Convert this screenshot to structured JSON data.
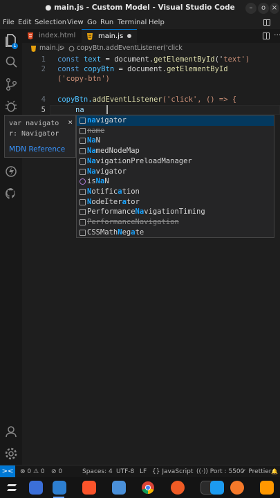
{
  "window": {
    "title": "● main.js - Custom Model - Visual Studio Code",
    "minimize": "–",
    "restore": "o",
    "close": "×"
  },
  "menu": [
    "File",
    "Edit",
    "Selection",
    "View",
    "Go",
    "Run",
    "Terminal",
    "Help"
  ],
  "tabs": [
    {
      "label": "index.html",
      "icon": "html-file-icon",
      "active": false
    },
    {
      "label": "main.js",
      "icon": "js-file-icon",
      "active": true,
      "modified": true
    }
  ],
  "breadcrumb": {
    "file": "main.js",
    "sep": "›",
    "symbol": "copyBtn.addEventListener('click"
  },
  "editor": {
    "line_numbers": [
      "1",
      "2",
      "3",
      "4",
      "5"
    ],
    "lines": [
      {
        "t1": "const ",
        "t2": "text",
        "t3": " = document.",
        "t4": "getElementById",
        "t5": "('",
        "t6": "text",
        "t7": "')"
      },
      {
        "t1": "const ",
        "t2": "copyBtn",
        "t3": " = document.",
        "t4": "getElementById"
      },
      {
        "t1": "('copy-btn')"
      },
      {
        "t1": "copyBtn.",
        "t2": "addEventListener",
        "t3": "('click', () => {"
      },
      {
        "t1": "na"
      }
    ]
  },
  "hover_doc": {
    "signature": "var navigator: Navigator",
    "close": "×",
    "link": "MDN Reference"
  },
  "suggestions": [
    {
      "label": "navigator",
      "match": "na",
      "rest": "vigator",
      "icon": "variable-icon",
      "selected": true
    },
    {
      "label": "name",
      "icon": "variable-icon",
      "deprecated": true
    },
    {
      "label": "NaN",
      "match": "Na",
      "rest": "N",
      "icon": "variable-icon"
    },
    {
      "label": "NamedNodeMap",
      "match": "Na",
      "rest": "medNodeMap",
      "icon": "variable-icon"
    },
    {
      "label": "NavigationPreloadManager",
      "match": "Na",
      "rest": "vigationPreloadManager",
      "icon": "variable-icon"
    },
    {
      "label": "Navigator",
      "match": "Na",
      "rest": "vigator",
      "icon": "variable-icon"
    },
    {
      "label": "isNaN",
      "pre": "is",
      "match": "Na",
      "rest": "N",
      "icon": "function-icon"
    },
    {
      "label": "Notification",
      "html": "<b>N</b>otific<b>a</b>tion",
      "icon": "variable-icon"
    },
    {
      "label": "NodeIterator",
      "html": "<b>N</b>odeIter<b>a</b>tor",
      "icon": "variable-icon"
    },
    {
      "label": "PerformanceNavigationTiming",
      "html": "Performance<b>Na</b>vigationTiming",
      "icon": "variable-icon"
    },
    {
      "label": "PerformanceNavigation",
      "icon": "variable-icon",
      "deprecated": true
    },
    {
      "label": "CSSMathNegate",
      "html": "CSSMath<b>N</b>eg<b>a</b>te",
      "icon": "variable-icon"
    }
  ],
  "status": {
    "remote": "><",
    "problems": "⊗ 0 ⚠ 0",
    "ports": "⊘ 0",
    "spaces": "Spaces: 4",
    "encoding": "UTF-8",
    "eol": "LF",
    "language": "{} JavaScript",
    "port": "((·)) Port : 5500",
    "prettier": "✓ Prettier",
    "bell": "🔔"
  },
  "taskbar": [
    "zorin-menu-icon",
    "window-switch-icon",
    "vscode-icon",
    "brave-icon",
    "files-icon",
    "chrome-icon",
    "postman-icon",
    "terminal-icon",
    "appstore-icon",
    "blender-icon",
    "sublime-icon"
  ],
  "colors": {
    "accent": "#0078d4",
    "match": "#18a3ff",
    "keyword": "#569cd6",
    "function": "#dcdcaa",
    "string": "#ce9178"
  }
}
